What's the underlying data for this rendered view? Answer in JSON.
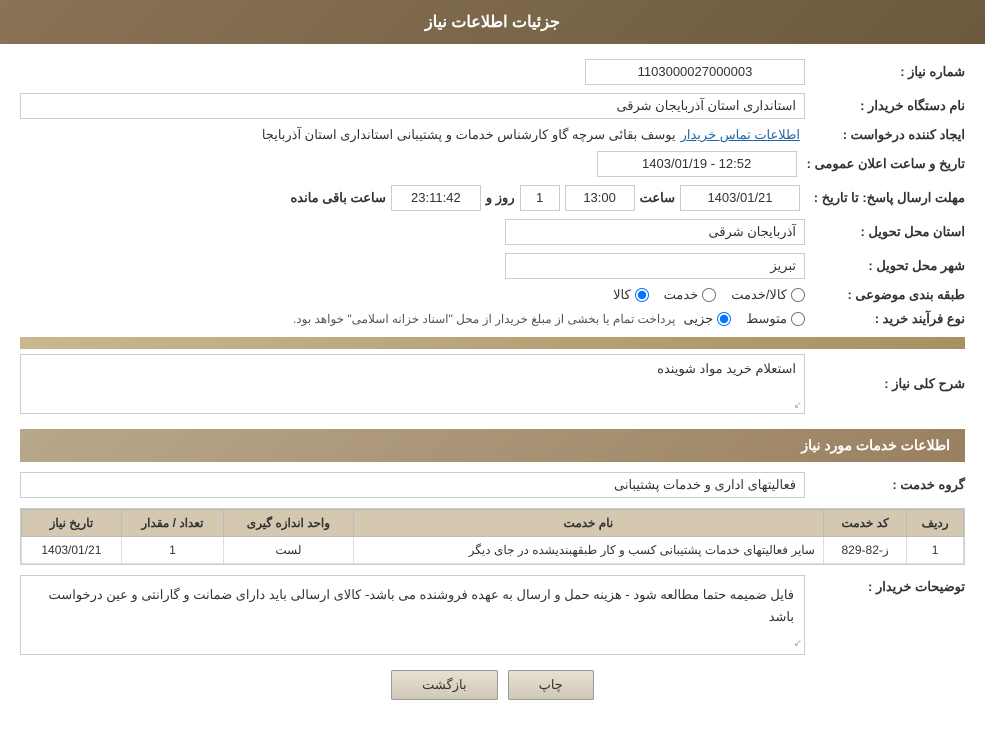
{
  "header": {
    "title": "جزئیات اطلاعات نیاز"
  },
  "fields": {
    "need_number_label": "شماره نیاز :",
    "need_number_value": "1103000027000003",
    "buyer_org_label": "نام دستگاه خریدار :",
    "buyer_org_value": "استانداری استان آذربایجان شرقی",
    "creator_label": "ایجاد کننده درخواست :",
    "creator_value": "یوسف بقائی سرچه گاو کارشناس خدمات و پشتیبانی استانداری استان آذربایجا",
    "creator_link": "اطلاعات تماس خریدار",
    "announce_date_label": "تاریخ و ساعت اعلان عمومی :",
    "announce_date_value": "1403/01/19 - 12:52",
    "deadline_label": "مهلت ارسال پاسخ: تا تاریخ :",
    "deadline_date": "1403/01/21",
    "deadline_time": "13:00",
    "deadline_days": "1",
    "deadline_remaining": "23:11:42",
    "deadline_days_label": "روز و",
    "deadline_remaining_label": "ساعت باقی مانده",
    "delivery_province_label": "استان محل تحویل :",
    "delivery_province_value": "آذربایجان شرقی",
    "delivery_city_label": "شهر محل تحویل :",
    "delivery_city_value": "تبریز",
    "category_label": "طبقه بندی موضوعی :",
    "category_kala": "کالا",
    "category_khedmat": "خدمت",
    "category_kala_khedmat": "کالا/خدمت",
    "purchase_type_label": "نوع فرآیند خرید :",
    "purchase_type_jozei": "جزیی",
    "purchase_type_motavaset": "متوسط",
    "purchase_type_note": "پرداخت تمام یا بخشی از مبلغ خریدار از محل \"اسناد خزانه اسلامی\" خواهد بود.",
    "description_label": "شرح کلی نیاز :",
    "description_value": "استعلام خرید مواد شوینده",
    "services_section_title": "اطلاعات خدمات مورد نیاز",
    "service_group_label": "گروه خدمت :",
    "service_group_value": "فعالیتهای اداری و خدمات پشتیبانی",
    "table_cols": {
      "row_num": "ردیف",
      "service_code": "کد خدمت",
      "service_name": "نام خدمت",
      "unit": "واحد اندازه گیری",
      "quantity": "تعداد / مقدار",
      "date": "تاریخ نیاز"
    },
    "table_rows": [
      {
        "row_num": "1",
        "service_code": "ز-82-829",
        "service_name": "سایر فعالیتهای خدمات پشتیبانی کسب و کار طبقهبندیشده در جای دیگر",
        "unit": "لست",
        "quantity": "1",
        "date": "1403/01/21"
      }
    ],
    "buyer_notes_label": "توضیحات خریدار :",
    "buyer_notes_value": "فایل ضمیمه حتما مطالعه شود - هزینه حمل و ارسال به عهده فروشنده می باشد- کالای ارسالی باید دارای ضمانت و گارانتی و عین درخواست باشد",
    "btn_print": "چاپ",
    "btn_back": "بازگشت"
  }
}
